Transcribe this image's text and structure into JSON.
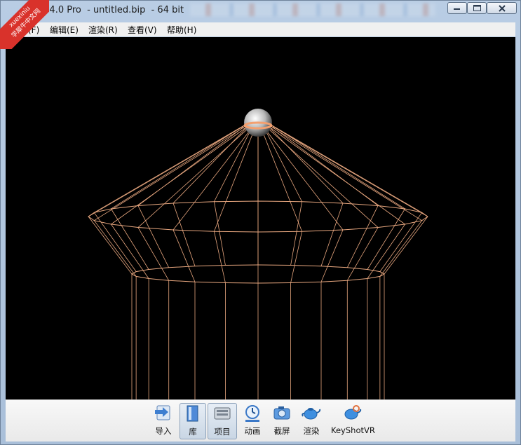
{
  "window": {
    "title": "hot 4.0 Pro  - untitled.bip  - 64 bit"
  },
  "watermark": {
    "line1": "xuexiniu",
    "line2": "学犀牛中文网",
    "color": "#d9322b"
  },
  "menubar": {
    "items": [
      {
        "label": "件(F)"
      },
      {
        "label": "编辑(E)"
      },
      {
        "label": "渲染(R)"
      },
      {
        "label": "查看(V)"
      },
      {
        "label": "帮助(H)"
      }
    ]
  },
  "viewport": {
    "background": "#000000",
    "wire_color": "#e8a77f"
  },
  "toolbar": {
    "items": [
      {
        "label": "导入",
        "icon": "import-icon"
      },
      {
        "label": "库",
        "icon": "library-icon",
        "active": true
      },
      {
        "label": "项目",
        "icon": "project-icon",
        "active": true
      },
      {
        "label": "动画",
        "icon": "animation-icon"
      },
      {
        "label": "截屏",
        "icon": "screenshot-icon"
      },
      {
        "label": "渲染",
        "icon": "render-teapot-icon"
      },
      {
        "label": "KeyShotVR",
        "icon": "keyshotvr-teapot-icon"
      }
    ]
  }
}
